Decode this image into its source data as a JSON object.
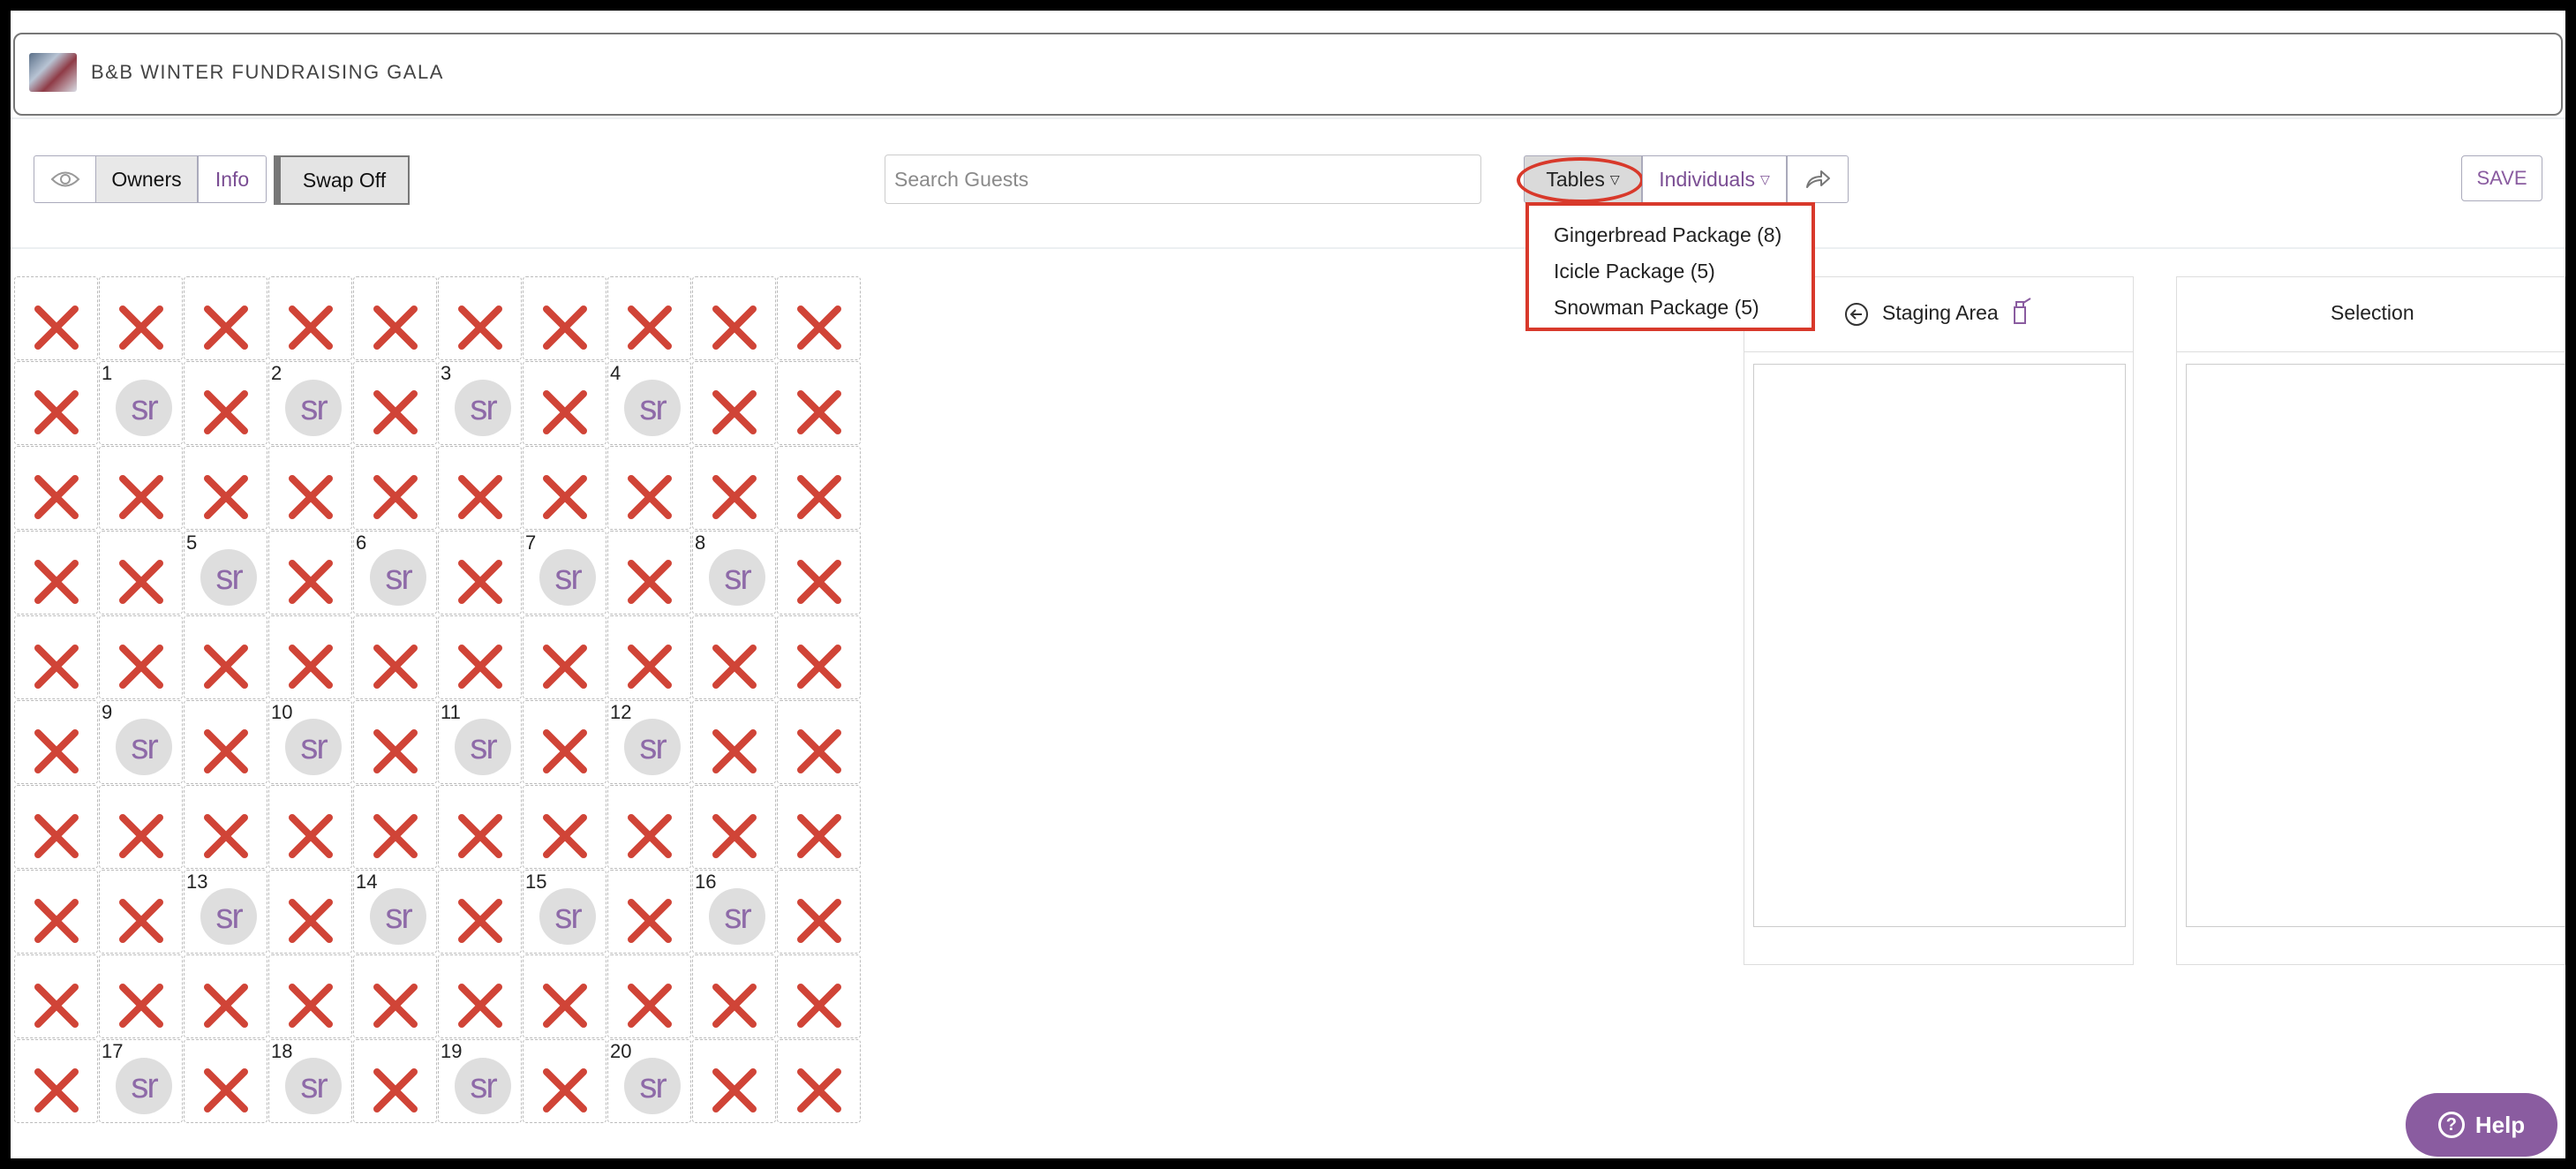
{
  "header": {
    "title": "B&B WINTER FUNDRAISING GALA",
    "logo_icon": "event-photo-logo"
  },
  "toolbar": {
    "eye_icon": "eye-icon",
    "owners_label": "Owners",
    "info_label": "Info",
    "swap_label": "Swap Off",
    "search_placeholder": "Search Guests",
    "tables_label": "Tables",
    "individuals_label": "Individuals",
    "share_icon": "share-arrow-icon",
    "save_label": "SAVE"
  },
  "tables_dropdown": {
    "items": [
      {
        "label": "Gingerbread Package (8)"
      },
      {
        "label": "Icicle Package (5)"
      },
      {
        "label": "Snowman Package (5)"
      }
    ]
  },
  "seating_grid": {
    "rows": 10,
    "cols": 10,
    "table_label": "sr",
    "tables": [
      {
        "number": "1",
        "row": 1,
        "col": 1
      },
      {
        "number": "2",
        "row": 1,
        "col": 3
      },
      {
        "number": "3",
        "row": 1,
        "col": 5
      },
      {
        "number": "4",
        "row": 1,
        "col": 7
      },
      {
        "number": "5",
        "row": 3,
        "col": 2
      },
      {
        "number": "6",
        "row": 3,
        "col": 4
      },
      {
        "number": "7",
        "row": 3,
        "col": 6
      },
      {
        "number": "8",
        "row": 3,
        "col": 8
      },
      {
        "number": "9",
        "row": 5,
        "col": 1
      },
      {
        "number": "10",
        "row": 5,
        "col": 3
      },
      {
        "number": "11",
        "row": 5,
        "col": 5
      },
      {
        "number": "12",
        "row": 5,
        "col": 7
      },
      {
        "number": "13",
        "row": 7,
        "col": 2
      },
      {
        "number": "14",
        "row": 7,
        "col": 4
      },
      {
        "number": "15",
        "row": 7,
        "col": 6
      },
      {
        "number": "16",
        "row": 7,
        "col": 8
      },
      {
        "number": "17",
        "row": 9,
        "col": 1
      },
      {
        "number": "18",
        "row": 9,
        "col": 3
      },
      {
        "number": "19",
        "row": 9,
        "col": 5
      },
      {
        "number": "20",
        "row": 9,
        "col": 7
      }
    ]
  },
  "staging_area": {
    "title": "Staging Area",
    "back_icon": "circle-arrow-left-icon",
    "clear_icon": "broom-icon"
  },
  "selection": {
    "title": "Selection"
  },
  "help": {
    "label": "Help",
    "icon": "question-circle-icon"
  },
  "colors": {
    "accent": "#8a5ca0",
    "highlight": "#d8392b",
    "blocked": "#d04437",
    "table_circle": "#dedede"
  }
}
